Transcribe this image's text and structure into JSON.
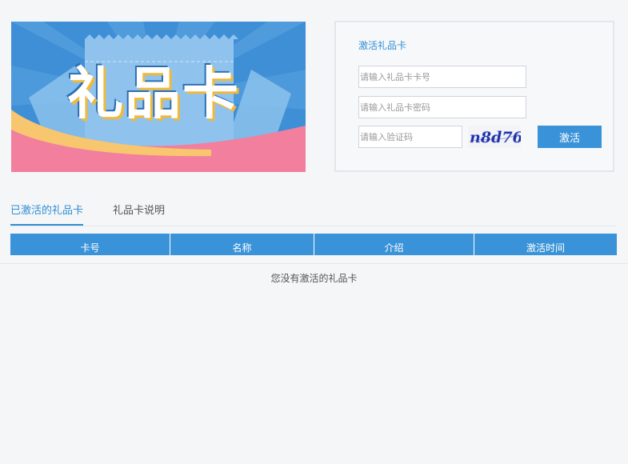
{
  "banner": {
    "title": "礼品卡",
    "colors": {
      "sky": "#3f8fd6",
      "ticket": "#7bb7e8",
      "pink": "#f27f9d",
      "gold": "#f7c66e"
    }
  },
  "form": {
    "title": "激活礼品卡",
    "card_number_placeholder": "请输入礼品卡卡号",
    "card_password_placeholder": "请输入礼品卡密码",
    "captcha_placeholder": "请输入验证码",
    "captcha_text": "n8d76",
    "activate_label": "激活"
  },
  "tabs": [
    {
      "label": "已激活的礼品卡",
      "active": true
    },
    {
      "label": "礼品卡说明",
      "active": false
    }
  ],
  "table": {
    "columns": [
      "卡号",
      "名称",
      "介绍",
      "激活时间"
    ],
    "rows": [],
    "empty_text": "您没有激活的礼品卡"
  },
  "colors": {
    "accent": "#3a93d8",
    "link": "#2f8fd4",
    "border": "#e3e6ea"
  }
}
